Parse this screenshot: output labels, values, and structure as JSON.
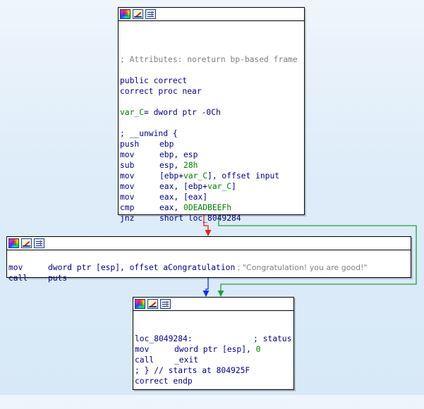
{
  "colors": {
    "edge_false": "#e02020",
    "edge_true": "#20a040",
    "edge_normal": "#1030e0",
    "code": "#000080",
    "comment": "#808080",
    "variable": "#008000"
  },
  "nodes": {
    "top": {
      "header_icons": [
        "color-palette-icon",
        "rename-icon",
        "graph-view-icon"
      ],
      "lines": {
        "comment": "; Attributes: noreturn bp-based frame",
        "public": "public correct",
        "proc": "correct proc near",
        "var_name": "var_C",
        "var_decl": "= dword ptr -0Ch",
        "unwind": "; __unwind {",
        "i1_mn": "push",
        "i1_op": "ebp",
        "i2_mn": "mov",
        "i2_op": "ebp, esp",
        "i3_mn": "sub",
        "i3_op_a": "esp, ",
        "i3_op_b": "28h",
        "i4_mn": "mov",
        "i4_op_a": "[ebp+",
        "i4_op_b": "var_C",
        "i4_op_c": "], offset input",
        "i5_mn": "mov",
        "i5_op_a": "eax, [ebp+",
        "i5_op_b": "var_C",
        "i5_op_c": "]",
        "i6_mn": "mov",
        "i6_op": "eax, [eax]",
        "i7_mn": "cmp",
        "i7_op_a": "eax, ",
        "i7_op_b": "0DEADBEEFh",
        "i8_mn": "jnz",
        "i8_op": "short loc_8049284"
      }
    },
    "middle": {
      "header_icons": [
        "color-palette-icon",
        "rename-icon",
        "graph-view-icon"
      ],
      "lines": {
        "i1_mn": "mov",
        "i1_op": "dword ptr [esp], offset aCongratulation",
        "i1_cmt": " ; \"Congratulation! you are good!\"",
        "i2_mn": "call",
        "i2_op": "puts"
      }
    },
    "bottom": {
      "header_icons": [
        "color-palette-icon",
        "rename-icon",
        "graph-view-icon"
      ],
      "lines": {
        "label": "loc_8049284:",
        "label_cmt": "; status",
        "i1_mn": "mov",
        "i1_op_a": "dword ptr [esp], ",
        "i1_op_b": "0",
        "i2_mn": "call",
        "i2_op": "_exit",
        "end_cmt": "; } // starts at 804925F",
        "endp": "correct endp"
      }
    }
  }
}
